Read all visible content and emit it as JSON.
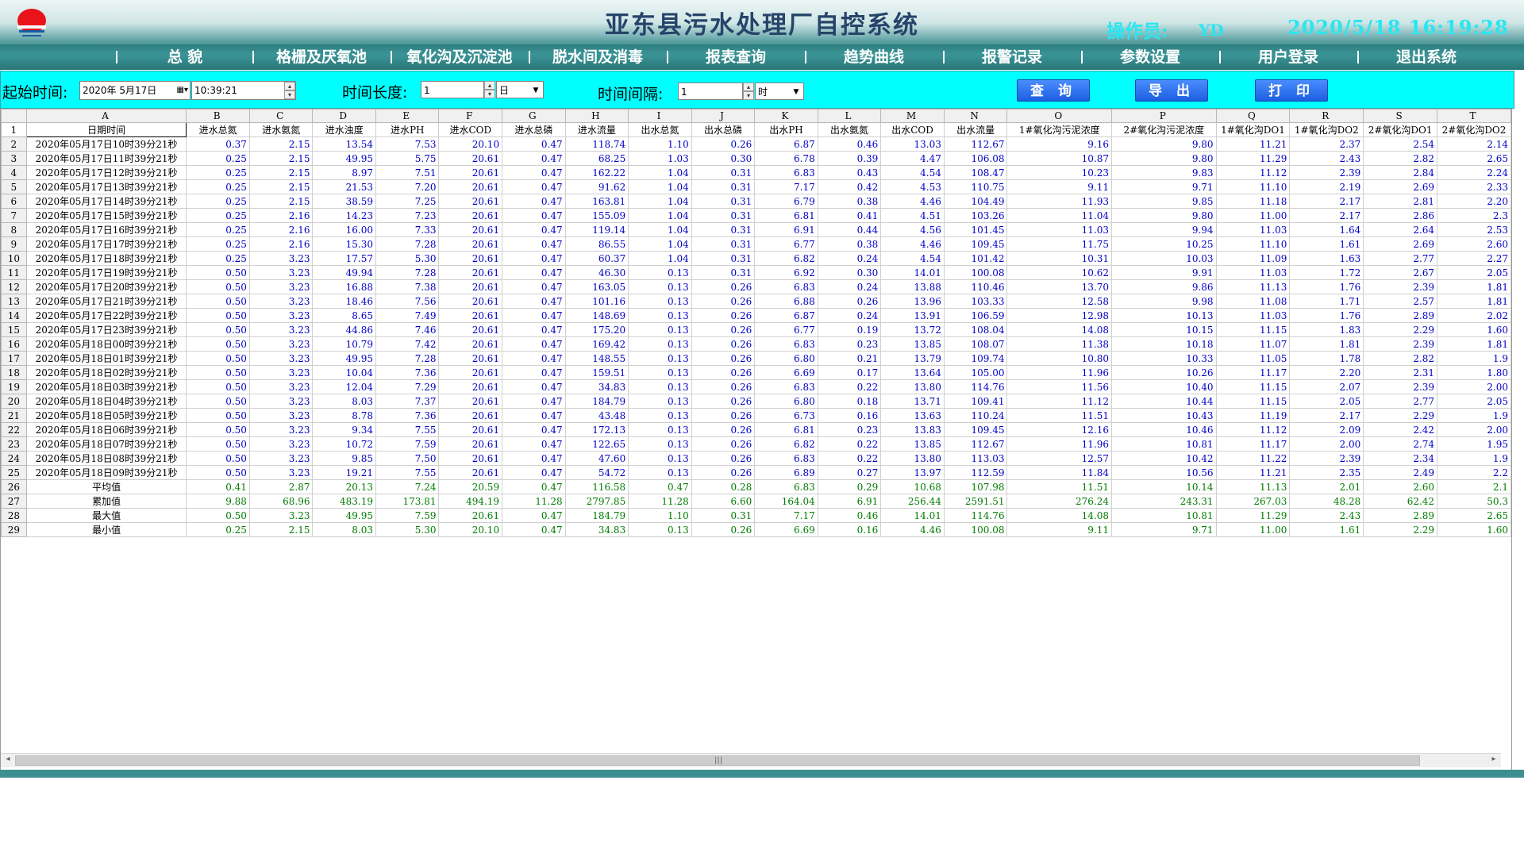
{
  "app": {
    "title": "亚东县污水处理厂自控系统",
    "operator_label": "操作员:",
    "operator_name": "YD",
    "datetime": "2020/5/18 16:19:28"
  },
  "menu": [
    "总 貌",
    "格栅及厌氧池",
    "氧化沟及沉淀池",
    "脱水间及消毒",
    "报表查询",
    "趋势曲线",
    "报警记录",
    "参数设置",
    "用户登录",
    "退出系统"
  ],
  "toolbar": {
    "start_label": "起始时间:",
    "start_date": "2020年 5月17日",
    "start_time": "10:39:21",
    "length_label": "时间长度:",
    "length_value": "1",
    "length_unit": "日",
    "interval_label": "时间间隔:",
    "interval_value": "1",
    "interval_unit": "时",
    "query_btn": "查 询",
    "export_btn": "导 出",
    "print_btn": "打 印"
  },
  "grid": {
    "col_letters": [
      "A",
      "B",
      "C",
      "D",
      "E",
      "F",
      "G",
      "H",
      "I",
      "J",
      "K",
      "L",
      "M",
      "N",
      "O",
      "P",
      "Q",
      "R",
      "S",
      "T"
    ],
    "fields": [
      "日期时间",
      "进水总氮",
      "进水氨氮",
      "进水浊度",
      "进水PH",
      "进水COD",
      "进水总磷",
      "进水流量",
      "出水总氮",
      "出水总磷",
      "出水PH",
      "出水氨氮",
      "出水COD",
      "出水流量",
      "1#氧化沟污泥浓度",
      "2#氧化沟污泥浓度",
      "1#氧化沟DO1",
      "1#氧化沟DO2",
      "2#氧化沟DO1",
      "2#氧化沟DO2"
    ],
    "rows": [
      [
        "2020年05月17日10时39分21秒",
        "0.37",
        "2.15",
        "13.54",
        "7.53",
        "20.10",
        "0.47",
        "118.74",
        "1.10",
        "0.26",
        "6.87",
        "0.46",
        "13.03",
        "112.67",
        "9.16",
        "9.80",
        "11.21",
        "2.37",
        "2.54",
        "2.14"
      ],
      [
        "2020年05月17日11时39分21秒",
        "0.25",
        "2.15",
        "49.95",
        "5.75",
        "20.61",
        "0.47",
        "68.25",
        "1.03",
        "0.30",
        "6.78",
        "0.39",
        "4.47",
        "106.08",
        "10.87",
        "9.80",
        "11.29",
        "2.43",
        "2.82",
        "2.65"
      ],
      [
        "2020年05月17日12时39分21秒",
        "0.25",
        "2.15",
        "8.97",
        "7.51",
        "20.61",
        "0.47",
        "162.22",
        "1.04",
        "0.31",
        "6.83",
        "0.43",
        "4.54",
        "108.47",
        "10.23",
        "9.83",
        "11.12",
        "2.39",
        "2.84",
        "2.24"
      ],
      [
        "2020年05月17日13时39分21秒",
        "0.25",
        "2.15",
        "21.53",
        "7.20",
        "20.61",
        "0.47",
        "91.62",
        "1.04",
        "0.31",
        "7.17",
        "0.42",
        "4.53",
        "110.75",
        "9.11",
        "9.71",
        "11.10",
        "2.19",
        "2.69",
        "2.33"
      ],
      [
        "2020年05月17日14时39分21秒",
        "0.25",
        "2.15",
        "38.59",
        "7.25",
        "20.61",
        "0.47",
        "163.81",
        "1.04",
        "0.31",
        "6.79",
        "0.38",
        "4.46",
        "104.49",
        "11.93",
        "9.85",
        "11.18",
        "2.17",
        "2.81",
        "2.20"
      ],
      [
        "2020年05月17日15时39分21秒",
        "0.25",
        "2.16",
        "14.23",
        "7.23",
        "20.61",
        "0.47",
        "155.09",
        "1.04",
        "0.31",
        "6.81",
        "0.41",
        "4.51",
        "103.26",
        "11.04",
        "9.80",
        "11.00",
        "2.17",
        "2.86",
        "2.3"
      ],
      [
        "2020年05月17日16时39分21秒",
        "0.25",
        "2.16",
        "16.00",
        "7.33",
        "20.61",
        "0.47",
        "119.14",
        "1.04",
        "0.31",
        "6.91",
        "0.44",
        "4.56",
        "101.45",
        "11.03",
        "9.94",
        "11.03",
        "1.64",
        "2.64",
        "2.53"
      ],
      [
        "2020年05月17日17时39分21秒",
        "0.25",
        "2.16",
        "15.30",
        "7.28",
        "20.61",
        "0.47",
        "86.55",
        "1.04",
        "0.31",
        "6.77",
        "0.38",
        "4.46",
        "109.45",
        "11.75",
        "10.25",
        "11.10",
        "1.61",
        "2.69",
        "2.60"
      ],
      [
        "2020年05月17日18时39分21秒",
        "0.25",
        "3.23",
        "17.57",
        "5.30",
        "20.61",
        "0.47",
        "60.37",
        "1.04",
        "0.31",
        "6.82",
        "0.24",
        "4.54",
        "101.42",
        "10.31",
        "10.03",
        "11.09",
        "1.63",
        "2.77",
        "2.27"
      ],
      [
        "2020年05月17日19时39分21秒",
        "0.50",
        "3.23",
        "49.94",
        "7.28",
        "20.61",
        "0.47",
        "46.30",
        "0.13",
        "0.31",
        "6.92",
        "0.30",
        "14.01",
        "100.08",
        "10.62",
        "9.91",
        "11.03",
        "1.72",
        "2.67",
        "2.05"
      ],
      [
        "2020年05月17日20时39分21秒",
        "0.50",
        "3.23",
        "16.88",
        "7.38",
        "20.61",
        "0.47",
        "163.05",
        "0.13",
        "0.26",
        "6.83",
        "0.24",
        "13.88",
        "110.46",
        "13.70",
        "9.86",
        "11.13",
        "1.76",
        "2.39",
        "1.81"
      ],
      [
        "2020年05月17日21时39分21秒",
        "0.50",
        "3.23",
        "18.46",
        "7.56",
        "20.61",
        "0.47",
        "101.16",
        "0.13",
        "0.26",
        "6.88",
        "0.26",
        "13.96",
        "103.33",
        "12.58",
        "9.98",
        "11.08",
        "1.71",
        "2.57",
        "1.81"
      ],
      [
        "2020年05月17日22时39分21秒",
        "0.50",
        "3.23",
        "8.65",
        "7.49",
        "20.61",
        "0.47",
        "148.69",
        "0.13",
        "0.26",
        "6.87",
        "0.24",
        "13.91",
        "106.59",
        "12.98",
        "10.13",
        "11.03",
        "1.76",
        "2.89",
        "2.02"
      ],
      [
        "2020年05月17日23时39分21秒",
        "0.50",
        "3.23",
        "44.86",
        "7.46",
        "20.61",
        "0.47",
        "175.20",
        "0.13",
        "0.26",
        "6.77",
        "0.19",
        "13.72",
        "108.04",
        "14.08",
        "10.15",
        "11.15",
        "1.83",
        "2.29",
        "1.60"
      ],
      [
        "2020年05月18日00时39分21秒",
        "0.50",
        "3.23",
        "10.79",
        "7.42",
        "20.61",
        "0.47",
        "169.42",
        "0.13",
        "0.26",
        "6.83",
        "0.23",
        "13.85",
        "108.07",
        "11.38",
        "10.18",
        "11.07",
        "1.81",
        "2.39",
        "1.81"
      ],
      [
        "2020年05月18日01时39分21秒",
        "0.50",
        "3.23",
        "49.95",
        "7.28",
        "20.61",
        "0.47",
        "148.55",
        "0.13",
        "0.26",
        "6.80",
        "0.21",
        "13.79",
        "109.74",
        "10.80",
        "10.33",
        "11.05",
        "1.78",
        "2.82",
        "1.9"
      ],
      [
        "2020年05月18日02时39分21秒",
        "0.50",
        "3.23",
        "10.04",
        "7.36",
        "20.61",
        "0.47",
        "159.51",
        "0.13",
        "0.26",
        "6.69",
        "0.17",
        "13.64",
        "105.00",
        "11.96",
        "10.26",
        "11.17",
        "2.20",
        "2.31",
        "1.80"
      ],
      [
        "2020年05月18日03时39分21秒",
        "0.50",
        "3.23",
        "12.04",
        "7.29",
        "20.61",
        "0.47",
        "34.83",
        "0.13",
        "0.26",
        "6.83",
        "0.22",
        "13.80",
        "114.76",
        "11.56",
        "10.40",
        "11.15",
        "2.07",
        "2.39",
        "2.00"
      ],
      [
        "2020年05月18日04时39分21秒",
        "0.50",
        "3.23",
        "8.03",
        "7.37",
        "20.61",
        "0.47",
        "184.79",
        "0.13",
        "0.26",
        "6.80",
        "0.18",
        "13.71",
        "109.41",
        "11.12",
        "10.44",
        "11.15",
        "2.05",
        "2.77",
        "2.05"
      ],
      [
        "2020年05月18日05时39分21秒",
        "0.50",
        "3.23",
        "8.78",
        "7.36",
        "20.61",
        "0.47",
        "43.48",
        "0.13",
        "0.26",
        "6.73",
        "0.16",
        "13.63",
        "110.24",
        "11.51",
        "10.43",
        "11.19",
        "2.17",
        "2.29",
        "1.9"
      ],
      [
        "2020年05月18日06时39分21秒",
        "0.50",
        "3.23",
        "9.34",
        "7.55",
        "20.61",
        "0.47",
        "172.13",
        "0.13",
        "0.26",
        "6.81",
        "0.23",
        "13.83",
        "109.45",
        "12.16",
        "10.46",
        "11.12",
        "2.09",
        "2.42",
        "2.00"
      ],
      [
        "2020年05月18日07时39分21秒",
        "0.50",
        "3.23",
        "10.72",
        "7.59",
        "20.61",
        "0.47",
        "122.65",
        "0.13",
        "0.26",
        "6.82",
        "0.22",
        "13.85",
        "112.67",
        "11.96",
        "10.81",
        "11.17",
        "2.00",
        "2.74",
        "1.95"
      ],
      [
        "2020年05月18日08时39分21秒",
        "0.50",
        "3.23",
        "9.85",
        "7.50",
        "20.61",
        "0.47",
        "47.60",
        "0.13",
        "0.26",
        "6.83",
        "0.22",
        "13.80",
        "113.03",
        "12.57",
        "10.42",
        "11.22",
        "2.39",
        "2.34",
        "1.9"
      ],
      [
        "2020年05月18日09时39分21秒",
        "0.50",
        "3.23",
        "19.21",
        "7.55",
        "20.61",
        "0.47",
        "54.72",
        "0.13",
        "0.26",
        "6.89",
        "0.27",
        "13.97",
        "112.59",
        "11.84",
        "10.56",
        "11.21",
        "2.35",
        "2.49",
        "2.2"
      ]
    ],
    "stats": [
      [
        "平均值",
        "0.41",
        "2.87",
        "20.13",
        "7.24",
        "20.59",
        "0.47",
        "116.58",
        "0.47",
        "0.28",
        "6.83",
        "0.29",
        "10.68",
        "107.98",
        "11.51",
        "10.14",
        "11.13",
        "2.01",
        "2.60",
        "2.1"
      ],
      [
        "累加值",
        "9.88",
        "68.96",
        "483.19",
        "173.81",
        "494.19",
        "11.28",
        "2797.85",
        "11.28",
        "6.60",
        "164.04",
        "6.91",
        "256.44",
        "2591.51",
        "276.24",
        "243.31",
        "267.03",
        "48.28",
        "62.42",
        "50.3"
      ],
      [
        "最大值",
        "0.50",
        "3.23",
        "49.95",
        "7.59",
        "20.61",
        "0.47",
        "184.79",
        "1.10",
        "0.31",
        "7.17",
        "0.46",
        "14.01",
        "114.76",
        "14.08",
        "10.81",
        "11.29",
        "2.43",
        "2.89",
        "2.65"
      ],
      [
        "最小值",
        "0.25",
        "2.15",
        "8.03",
        "5.30",
        "20.10",
        "0.47",
        "34.83",
        "0.13",
        "0.26",
        "6.69",
        "0.16",
        "4.46",
        "100.08",
        "9.11",
        "9.71",
        "11.00",
        "1.61",
        "2.29",
        "1.60"
      ]
    ]
  },
  "colors": {
    "title": "#27446a",
    "accent_cyan": "#29e6f0",
    "toolbar_bg": "#00ffff",
    "menu_bg": "#3a9597",
    "value_blue": "#0000c8",
    "stat_green": "#007c00",
    "button_blue": "#1c5fe0"
  }
}
